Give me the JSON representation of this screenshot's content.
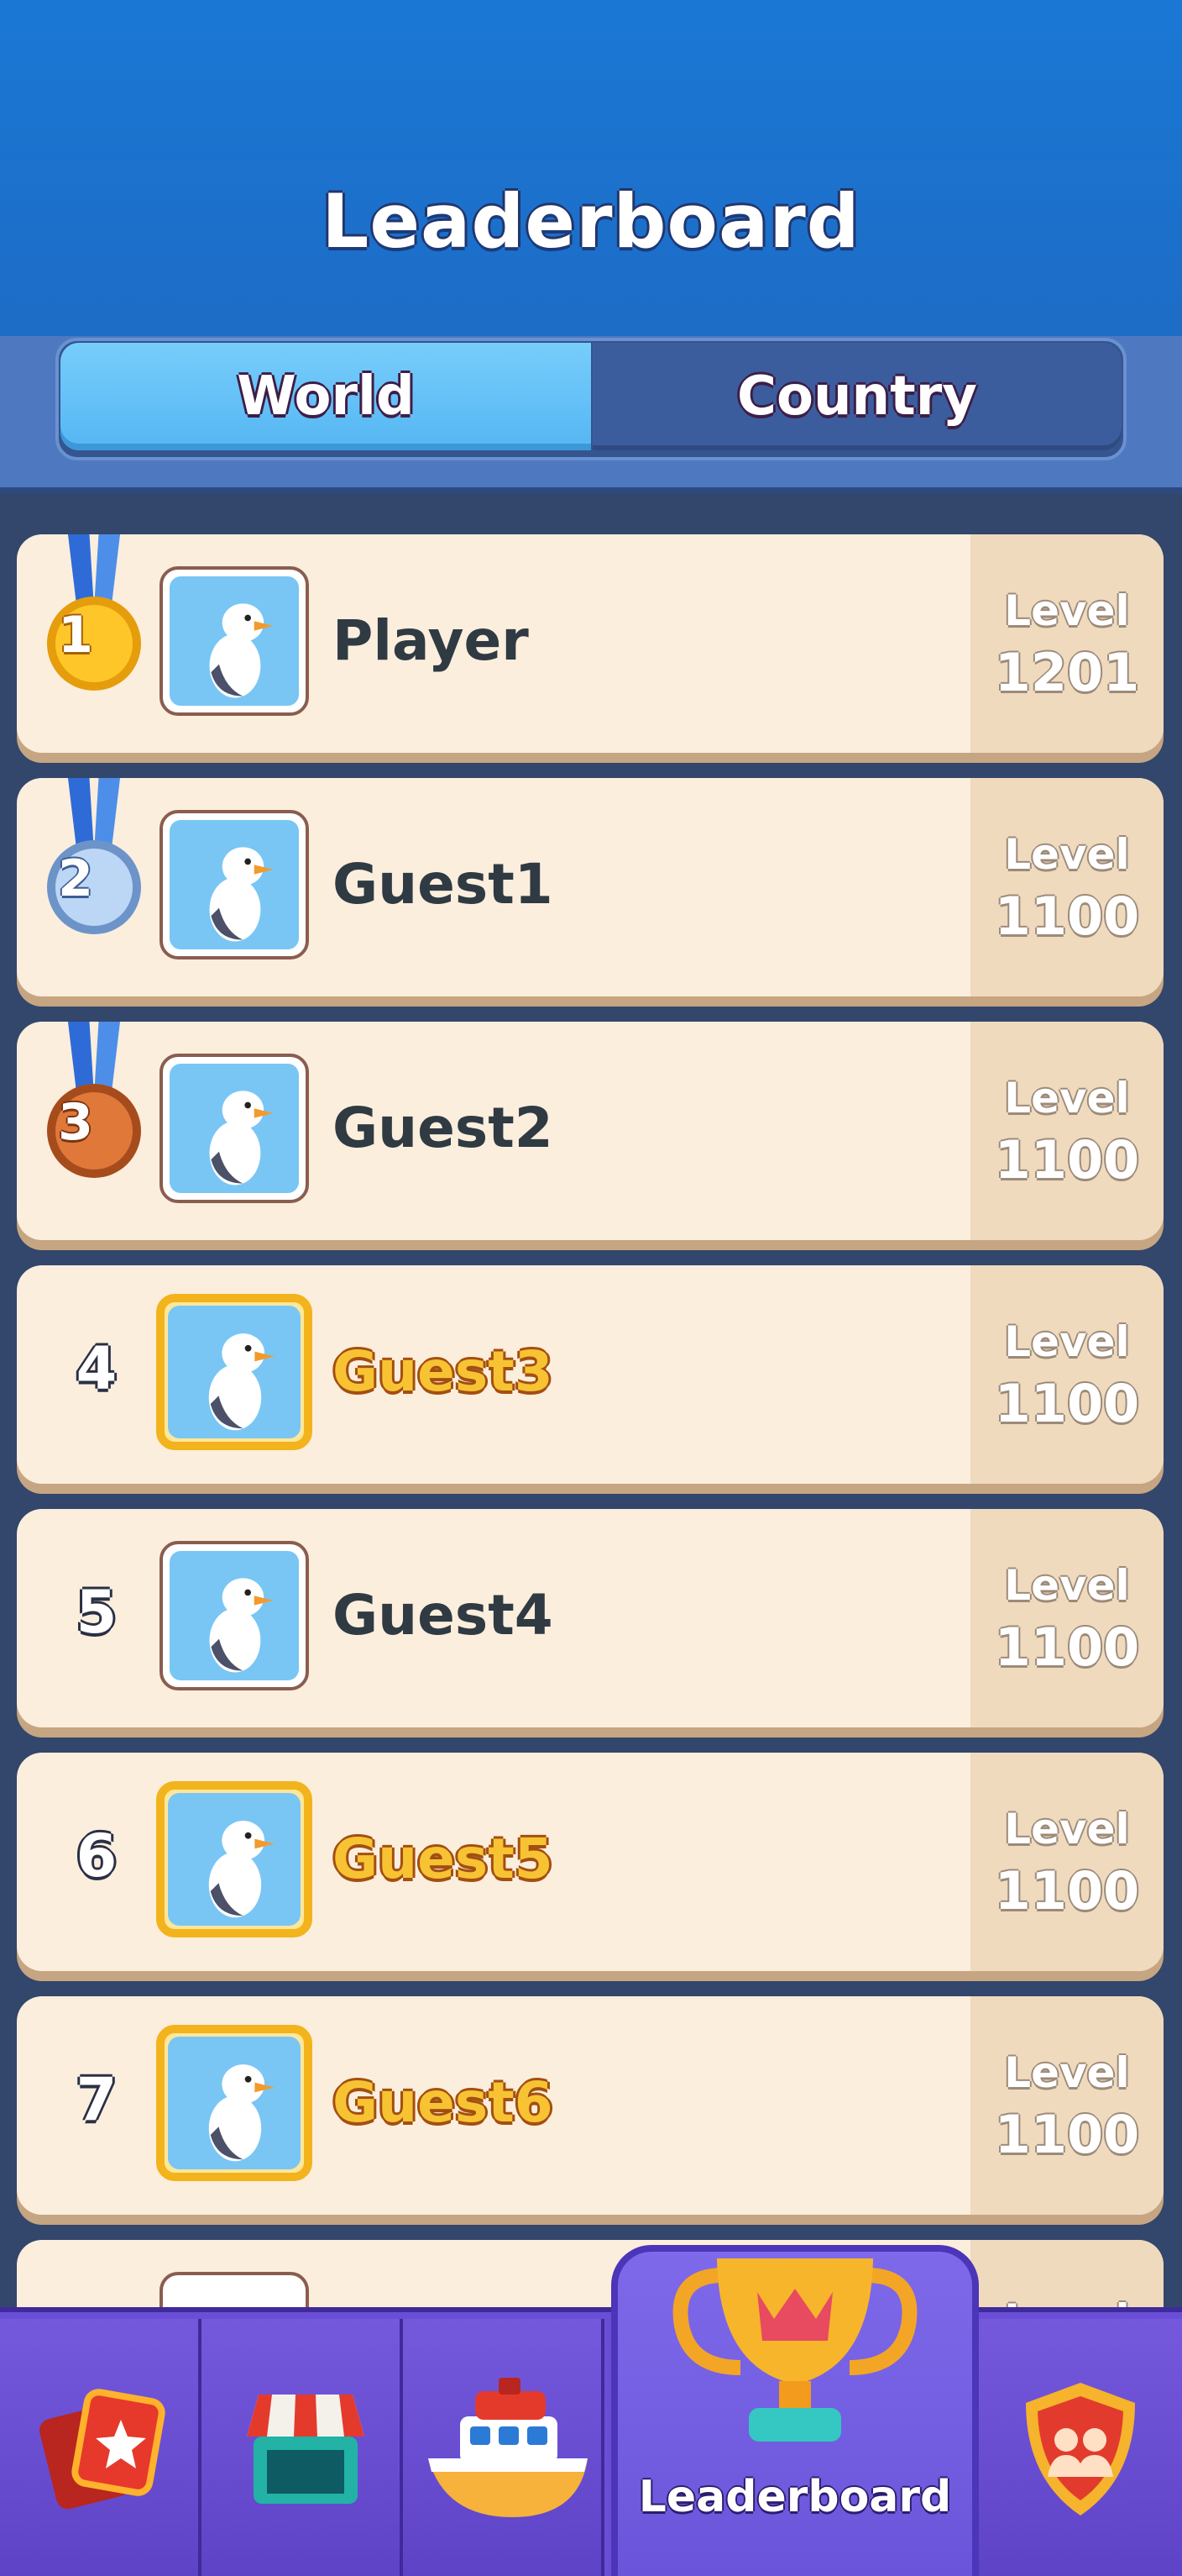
{
  "header": {
    "title": "Leaderboard"
  },
  "tabs": {
    "world": "World",
    "country": "Country",
    "active": "World"
  },
  "level_label": "Level",
  "rows": [
    {
      "rank": "1",
      "name": "Player",
      "level": "1201",
      "medal": "gold",
      "highlight": false
    },
    {
      "rank": "2",
      "name": "Guest1",
      "level": "1100",
      "medal": "silver",
      "highlight": false
    },
    {
      "rank": "3",
      "name": "Guest2",
      "level": "1100",
      "medal": "bronze",
      "highlight": false
    },
    {
      "rank": "4",
      "name": "Guest3",
      "level": "1100",
      "medal": "",
      "highlight": true
    },
    {
      "rank": "5",
      "name": "Guest4",
      "level": "1100",
      "medal": "",
      "highlight": false
    },
    {
      "rank": "6",
      "name": "Guest5",
      "level": "1100",
      "medal": "",
      "highlight": true
    },
    {
      "rank": "7",
      "name": "Guest6",
      "level": "1100",
      "medal": "",
      "highlight": true
    }
  ],
  "partial_row": {
    "level_label": "Level"
  },
  "bottom_nav": {
    "items": [
      {
        "icon": "cards-icon"
      },
      {
        "icon": "shop-icon"
      },
      {
        "icon": "boat-icon"
      },
      {
        "icon": "trophy-icon",
        "label": "Leaderboard",
        "active": true
      },
      {
        "icon": "team-shield-icon"
      }
    ],
    "active_label": "Leaderboard"
  },
  "colors": {
    "header": "#1a78d4",
    "tab_active": "#55b6f3",
    "tab_inactive": "#3c5d9d",
    "row_bg": "#fbeedd",
    "gold_name": "#f7c333",
    "nav": "#6a4fd6"
  }
}
